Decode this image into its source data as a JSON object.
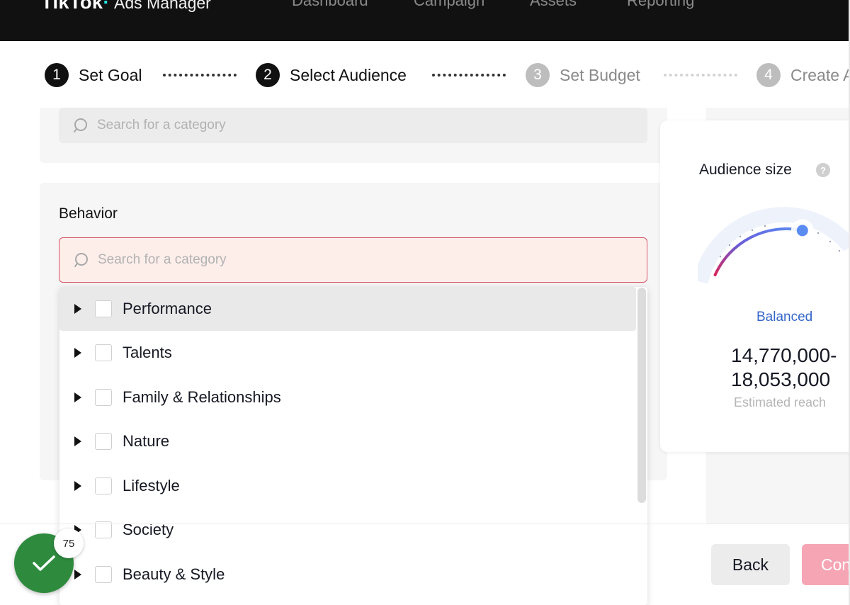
{
  "header": {
    "brand": "TikTok",
    "brand_dot": "·",
    "product": "Ads Manager",
    "nav": [
      "Dashboard",
      "Campaign",
      "Assets",
      "Reporting"
    ]
  },
  "steps": [
    {
      "number": "1",
      "label": "Set Goal",
      "state": "active"
    },
    {
      "number": "2",
      "label": "Select Audience",
      "state": "active"
    },
    {
      "number": "3",
      "label": "Set Budget",
      "state": "inactive"
    },
    {
      "number": "4",
      "label": "Create Ad",
      "state": "inactive"
    }
  ],
  "interest_search": {
    "placeholder": "Search for a category"
  },
  "behavior": {
    "title": "Behavior",
    "search_placeholder": "Search for a category",
    "categories": [
      "Performance",
      "Talents",
      "Family & Relationships",
      "Nature",
      "Lifestyle",
      "Society",
      "Beauty & Style"
    ]
  },
  "audience": {
    "title": "Audience size",
    "help": "?",
    "status": "Balanced",
    "reach_line1": "14,770,000-",
    "reach_line2": "18,053,000",
    "reach_label": "Estimated reach",
    "gauge_level": 0.55
  },
  "footer": {
    "back_label": "Back",
    "continue_label": "Continue"
  },
  "badge": {
    "count": "75"
  },
  "colors": {
    "accent": "#fe2c55",
    "balanced_blue": "#3466c9",
    "badge_green": "#2e8b3e",
    "error_border": "#d9536a"
  }
}
